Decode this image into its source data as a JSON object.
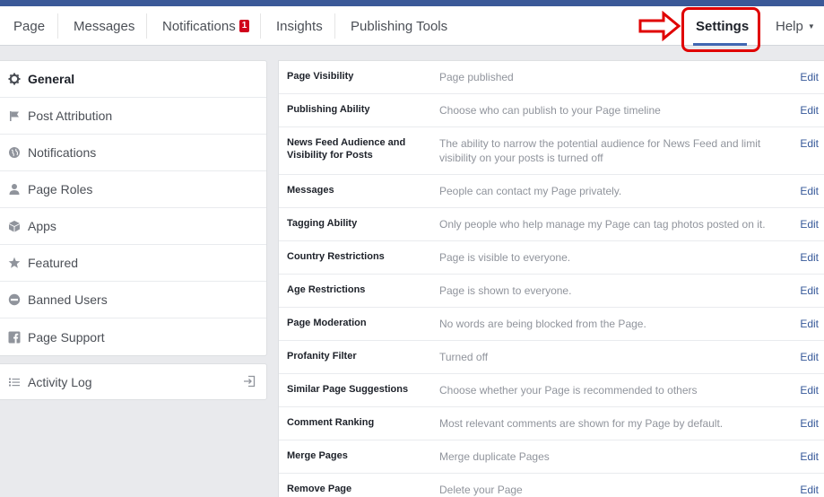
{
  "nav": {
    "items": [
      "Page",
      "Messages",
      "Notifications",
      "Insights",
      "Publishing Tools"
    ],
    "notifications_badge": "1",
    "settings": "Settings",
    "help": "Help"
  },
  "sidebar": {
    "items": [
      {
        "label": "General",
        "icon": "gear-icon"
      },
      {
        "label": "Post Attribution",
        "icon": "flag-icon"
      },
      {
        "label": "Notifications",
        "icon": "globe-icon"
      },
      {
        "label": "Page Roles",
        "icon": "person-icon"
      },
      {
        "label": "Apps",
        "icon": "cube-icon"
      },
      {
        "label": "Featured",
        "icon": "star-icon"
      },
      {
        "label": "Banned Users",
        "icon": "ban-icon"
      },
      {
        "label": "Page Support",
        "icon": "facebook-icon"
      }
    ],
    "activity_log": "Activity Log"
  },
  "settings": {
    "edit_label": "Edit",
    "rows": [
      {
        "label": "Page Visibility",
        "value": "Page published"
      },
      {
        "label": "Publishing Ability",
        "value": "Choose who can publish to your Page timeline"
      },
      {
        "label": "News Feed Audience and Visibility for Posts",
        "value": "The ability to narrow the potential audience for News Feed and limit visibility on your posts is turned off"
      },
      {
        "label": "Messages",
        "value": "People can contact my Page privately."
      },
      {
        "label": "Tagging Ability",
        "value": "Only people who help manage my Page can tag photos posted on it."
      },
      {
        "label": "Country Restrictions",
        "value": "Page is visible to everyone."
      },
      {
        "label": "Age Restrictions",
        "value": "Page is shown to everyone."
      },
      {
        "label": "Page Moderation",
        "value": "No words are being blocked from the Page."
      },
      {
        "label": "Profanity Filter",
        "value": "Turned off"
      },
      {
        "label": "Similar Page Suggestions",
        "value": "Choose whether your Page is recommended to others"
      },
      {
        "label": "Comment Ranking",
        "value": "Most relevant comments are shown for my Page by default."
      },
      {
        "label": "Merge Pages",
        "value": "Merge duplicate Pages"
      },
      {
        "label": "Remove Page",
        "value": "Delete your Page"
      }
    ]
  },
  "colors": {
    "brand": "#3b5998",
    "annotation": "#e00000",
    "link": "#365899"
  }
}
